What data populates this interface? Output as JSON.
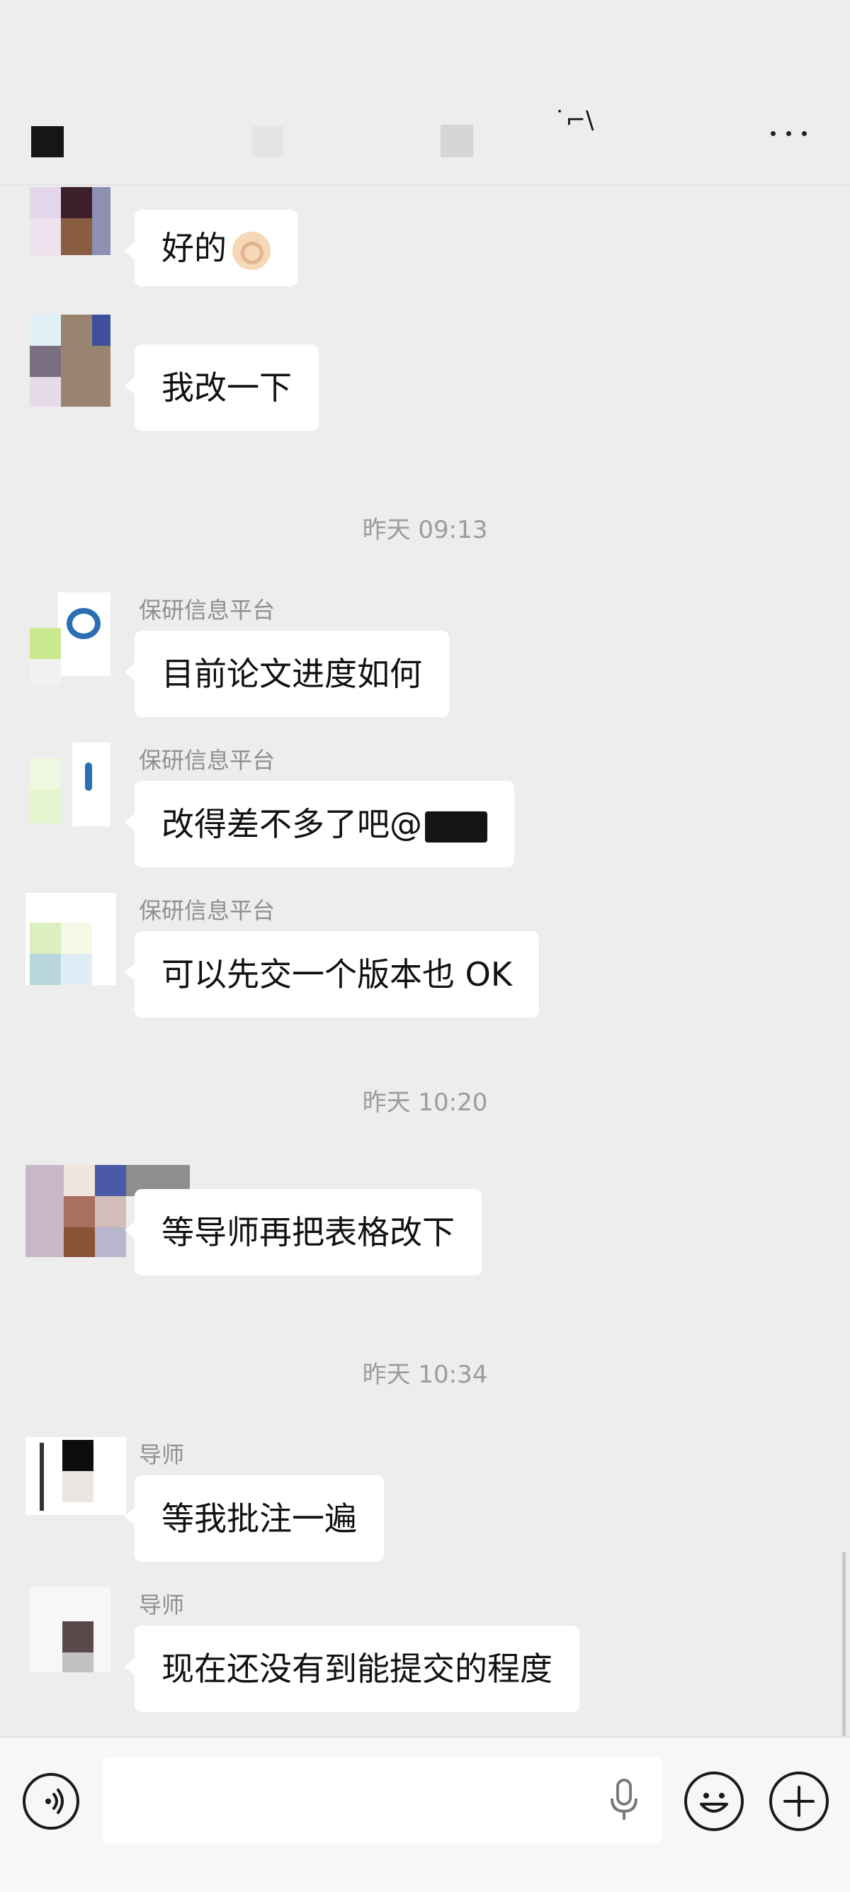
{
  "header": {
    "title_glyph": "˙⌐\\"
  },
  "chat": {
    "timestamps": [
      "昨天 09:13",
      "昨天 10:20",
      "昨天 10:34"
    ],
    "messages": [
      {
        "sender": "",
        "text": "好的"
      },
      {
        "sender": "",
        "text": "我改一下"
      },
      {
        "sender": "保研信息平台",
        "text": "目前论文进度如何"
      },
      {
        "sender": "保研信息平台",
        "text": "改得差不多了吧@"
      },
      {
        "sender": "保研信息平台",
        "text": "可以先交一个版本也 OK"
      },
      {
        "sender": "",
        "text": "等导师再把表格改下"
      },
      {
        "sender": "导师",
        "text": "等我批注一遍"
      },
      {
        "sender": "导师",
        "text": "现在还没有到能提交的程度"
      }
    ]
  },
  "input": {
    "placeholder": ""
  },
  "icons": {
    "back": "back-icon",
    "more": "more-icon",
    "voice": "voice-icon",
    "mic": "mic-icon",
    "emoji": "emoji-icon",
    "plus": "plus-icon"
  },
  "colors": {
    "background": "#ededed",
    "bubble": "#ffffff",
    "timestamp": "#9c9c9c"
  }
}
